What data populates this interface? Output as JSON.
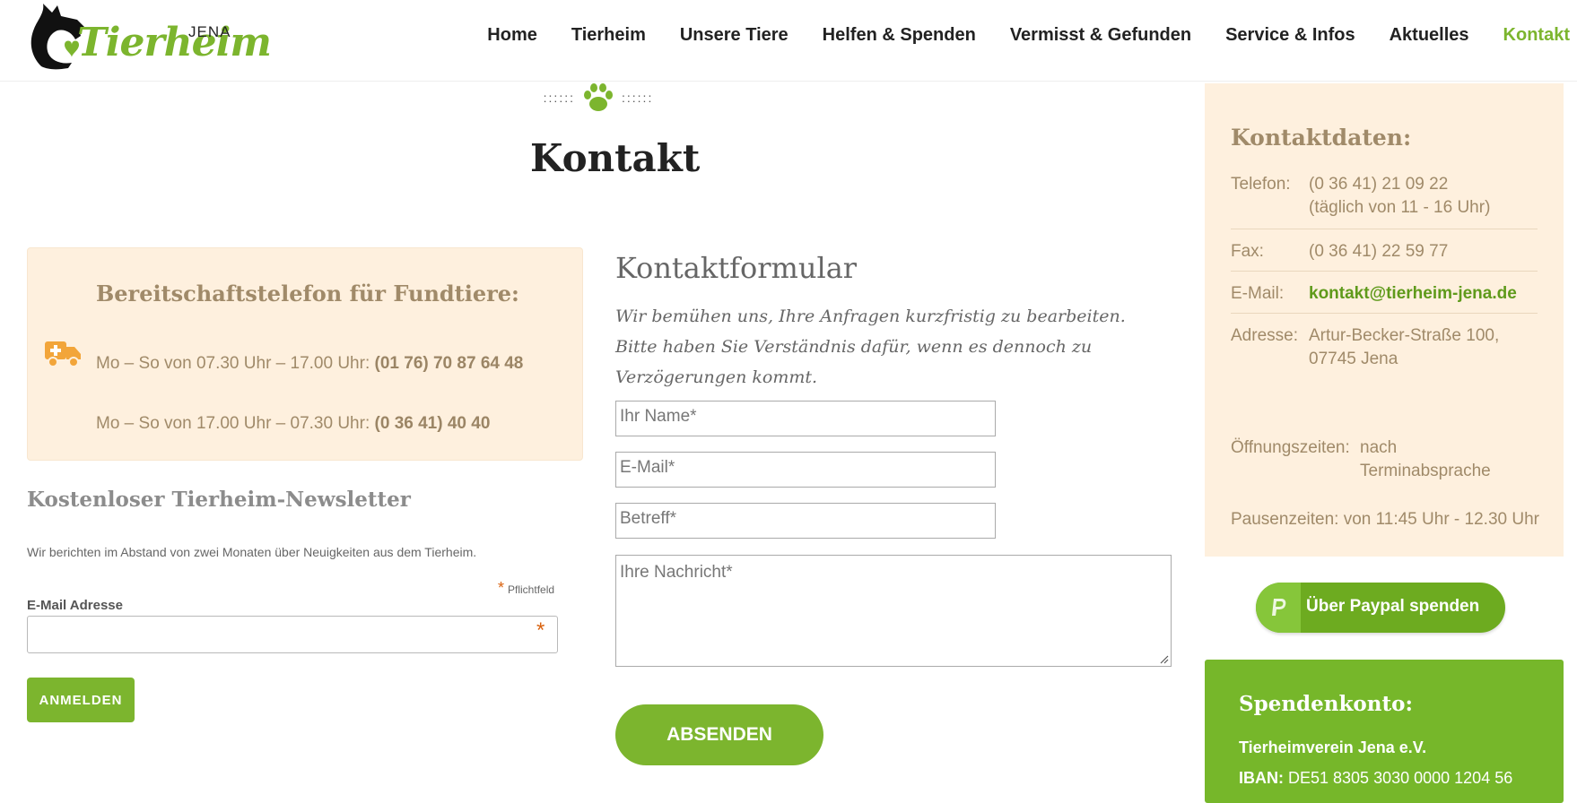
{
  "header": {
    "logo": {
      "wordmark": "Tierheim",
      "city": "JENA"
    },
    "nav": [
      {
        "label": "Home"
      },
      {
        "label": "Tierheim"
      },
      {
        "label": "Unsere Tiere"
      },
      {
        "label": "Helfen & Spenden"
      },
      {
        "label": "Vermisst & Gefunden"
      },
      {
        "label": "Service & Infos"
      },
      {
        "label": "Aktuelles"
      },
      {
        "label": "Kontakt",
        "active": true
      }
    ]
  },
  "page": {
    "divider_left": "::::::",
    "divider_right": "::::::",
    "title": "Kontakt"
  },
  "emergency": {
    "title": "Bereitschaftstelefon für Fundtiere:",
    "line1_text": "Mo – So von 07.30 Uhr – 17.00 Uhr: ",
    "line1_phone": "(01 76) 70 87 64 48",
    "line2_text": "Mo – So von 17.00 Uhr – 07.30 Uhr: ",
    "line2_phone": "(0 36 41) 40 40"
  },
  "newsletter": {
    "title": "Kostenloser Tierheim-Newsletter",
    "description": "Wir berichten im Abstand von zwei Monaten über Neuigkeiten aus dem Tierheim.",
    "required_note": "Pflichtfeld",
    "email_label": "E-Mail Adresse",
    "email_value": "",
    "submit_label": "ANMELDEN"
  },
  "contact_form": {
    "title": "Kontaktformular",
    "intro": "Wir bemühen uns, Ihre Anfragen kurzfristig zu bearbeiten. Bitte haben Sie Verständnis dafür, wenn es dennoch zu Verzögerungen kommt.",
    "name_placeholder": "Ihr Name*",
    "email_placeholder": "E-Mail*",
    "subject_placeholder": "Betreff*",
    "message_placeholder": "Ihre Nachricht*",
    "submit_label": "ABSENDEN"
  },
  "contact_details": {
    "title": "Kontaktdaten:",
    "phone_label": "Telefon:",
    "phone_value": "(0 36 41) 21 09 22",
    "phone_note": "(täglich von 11 - 16 Uhr)",
    "fax_label": "Fax:",
    "fax_value": "(0 36 41) 22 59 77",
    "email_label": "E-Mail:",
    "email_value": "kontakt@tierheim-jena.de",
    "address_label": "Adresse:",
    "address_line1": "Artur-Becker-Straße 100,",
    "address_line2": "07745 Jena",
    "hours_label": "Öffnungszeiten:",
    "hours_value1": "nach",
    "hours_value2": "Terminabsprache",
    "breaks": "Pausenzeiten: von 11:45 Uhr - 12.30 Uhr"
  },
  "paypal": {
    "label": "Über Paypal spenden"
  },
  "donation": {
    "title": "Spendenkonto:",
    "org": "Tierheimverein Jena e.V.",
    "iban_label": "IBAN:",
    "iban_value": " DE51 8305 3030 0000 1204 56"
  },
  "colors": {
    "accent_green": "#7cb52e",
    "panel_beige": "#fef0de",
    "panel_text": "#a08a69",
    "required_orange": "#d9620f"
  }
}
